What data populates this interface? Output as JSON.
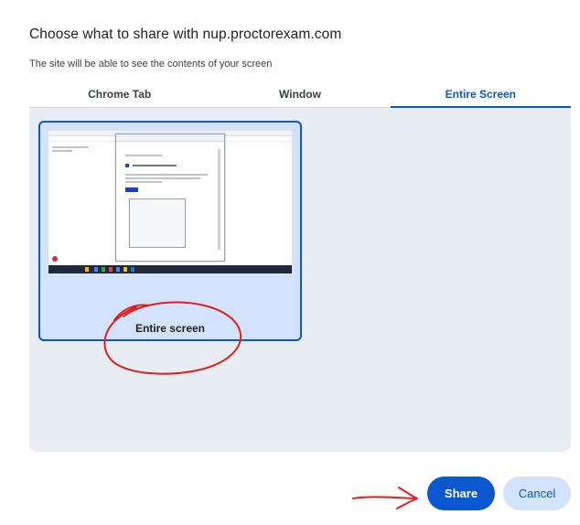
{
  "dialog": {
    "title": "Choose what to share with nup.proctorexam.com",
    "subtitle": "The site will be able to see the contents of your screen"
  },
  "tabs": [
    {
      "label": "Chrome Tab",
      "active": false
    },
    {
      "label": "Window",
      "active": false
    },
    {
      "label": "Entire Screen",
      "active": true
    }
  ],
  "sources": [
    {
      "label": "Entire screen",
      "selected": true
    }
  ],
  "buttons": {
    "share_label": "Share",
    "cancel_label": "Cancel"
  },
  "colors": {
    "accent": "#0b57d0",
    "selected_bg": "#d3e3fd",
    "panel_bg": "#e8edf4",
    "annotation": "#e0201b"
  }
}
